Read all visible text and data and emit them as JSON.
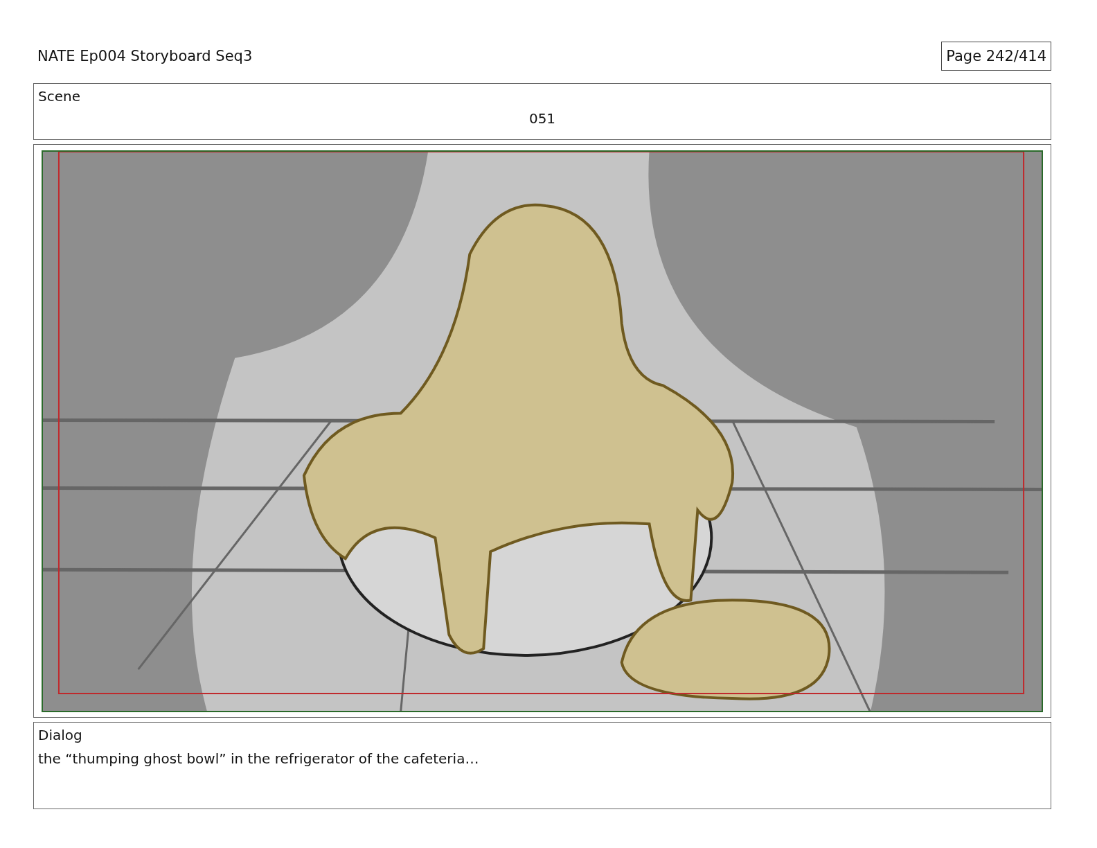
{
  "header": {
    "title": "NATE Ep004 Storyboard Seq3",
    "page": "Page 242/414"
  },
  "scene": {
    "label": "Scene",
    "value": "051"
  },
  "dialog": {
    "label": "Dialog",
    "text": "the “thumping ghost bowl” in the refrigerator of the cafeteria…"
  }
}
